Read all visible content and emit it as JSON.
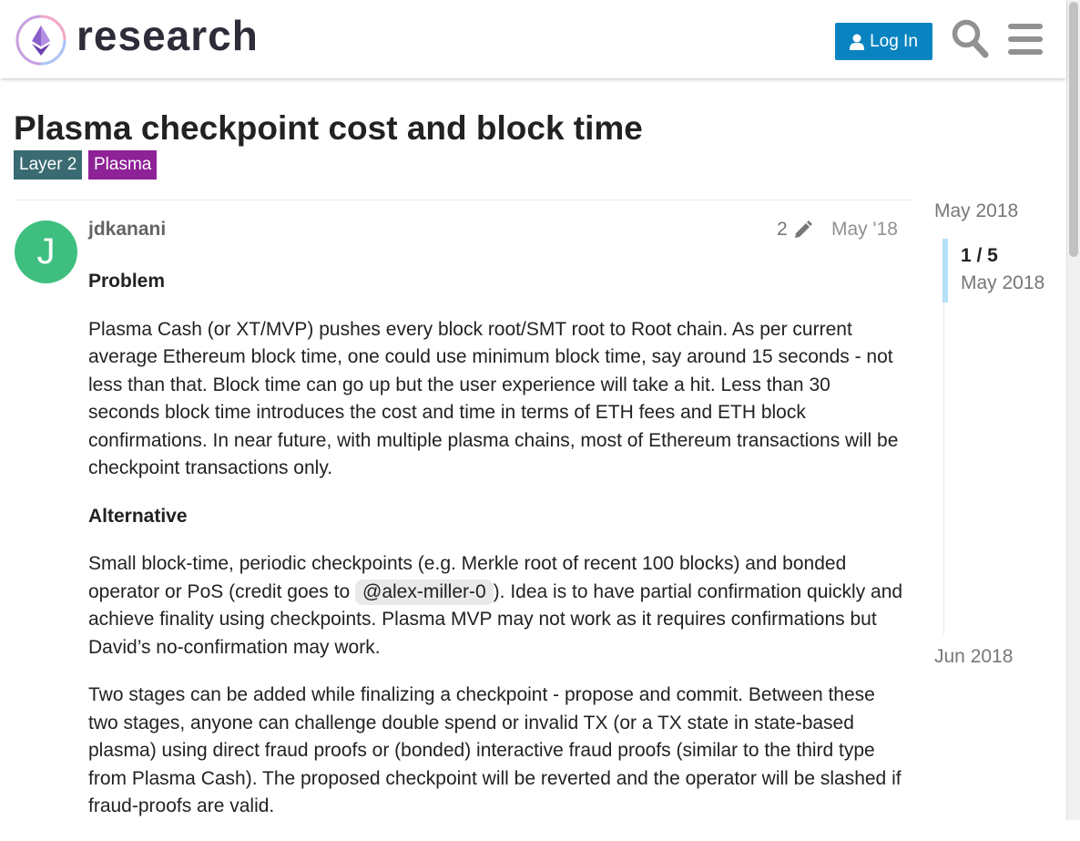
{
  "header": {
    "logo_text": "research",
    "login_label": "Log In",
    "icons": [
      "user-icon",
      "search-icon",
      "menu-icon"
    ]
  },
  "topic": {
    "title": "Plasma checkpoint cost and block time",
    "tags": [
      {
        "label": "Layer 2",
        "color": "#3a6b72"
      },
      {
        "label": "Plasma",
        "color": "#8e2196"
      }
    ]
  },
  "post": {
    "avatar_letter": "J",
    "avatar_color": "#3fbf7f",
    "username": "jdkanani",
    "edit_count": "2",
    "date": "May '18",
    "heading_problem": "Problem",
    "problem_text": "Plasma Cash (or XT/MVP) pushes every block root/SMT root to Root chain. As per current average Ethereum block time, one could use minimum block time, say around 15 seconds - not less than that. Block time can go up but the user experience will take a hit. Less than 30 seconds block time introduces the cost and time in terms of ETH fees and ETH block confirmations. In near future, with multiple plasma chains, most of Ethereum transactions will be checkpoint transactions only.",
    "heading_alternative": "Alternative",
    "alt_text_before": "Small block-time, periodic checkpoints (e.g. Merkle root of recent 100 blocks) and bonded operator or PoS (credit goes to ",
    "mention": "@alex-miller-0",
    "alt_text_after": "). Idea is to have partial confirmation quickly and achieve finality using checkpoints. Plasma MVP may not work as it requires confirmations but David’s no-confirmation may work.",
    "stages_text": "Two stages can be added while finalizing a checkpoint - propose and commit. Between these two stages, anyone can challenge double spend or invalid TX (or a TX state in state-based plasma) using direct fraud proofs or (bonded) interactive fraud proofs (similar to the third type from Plasma Cash). The proposed checkpoint will be reverted and the operator will be slashed if fraud-proofs are valid."
  },
  "timeline": {
    "start_date": "May 2018",
    "position": "1 / 5",
    "position_date": "May 2018",
    "end_date": "Jun 2018"
  }
}
